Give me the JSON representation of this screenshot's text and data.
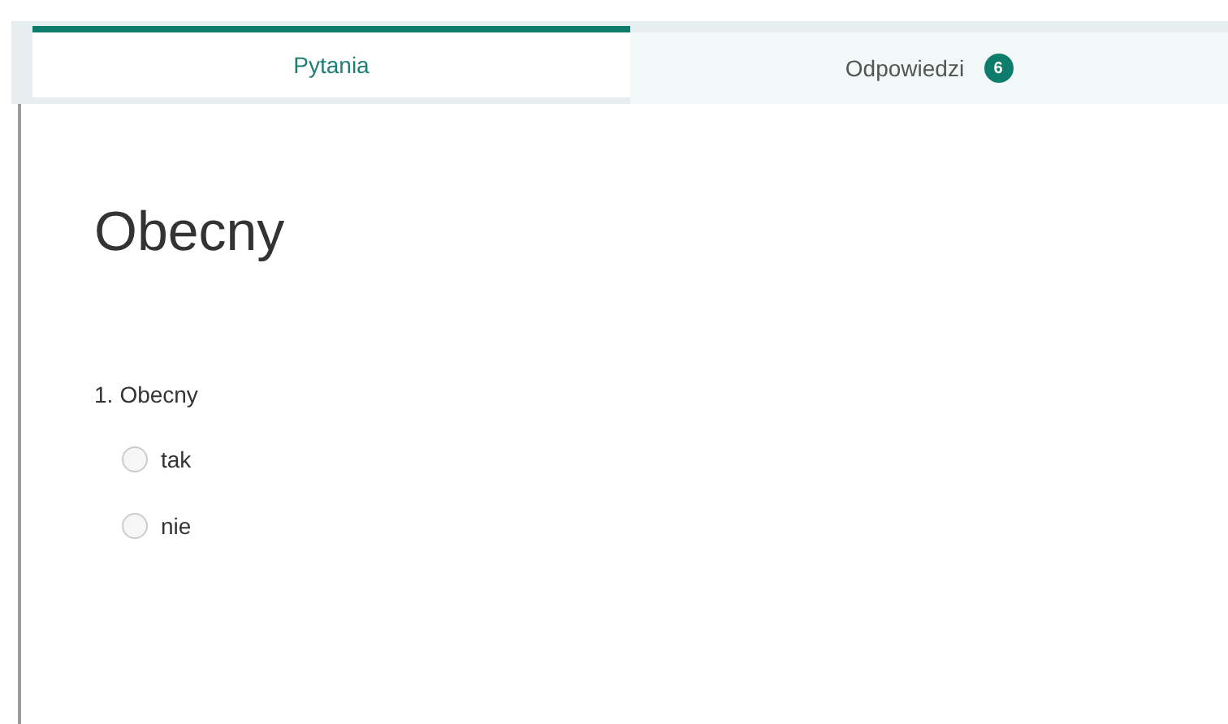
{
  "tabs": [
    {
      "label": "Pytania",
      "selected": true
    },
    {
      "label": "Odpowiedzi",
      "selected": false,
      "badge": "6"
    }
  ],
  "form": {
    "title": "Obecny",
    "questions": [
      {
        "number": "1.",
        "title": "Obecny",
        "options": [
          {
            "label": "tak",
            "selected": false
          },
          {
            "label": "nie",
            "selected": false
          }
        ]
      }
    ]
  }
}
